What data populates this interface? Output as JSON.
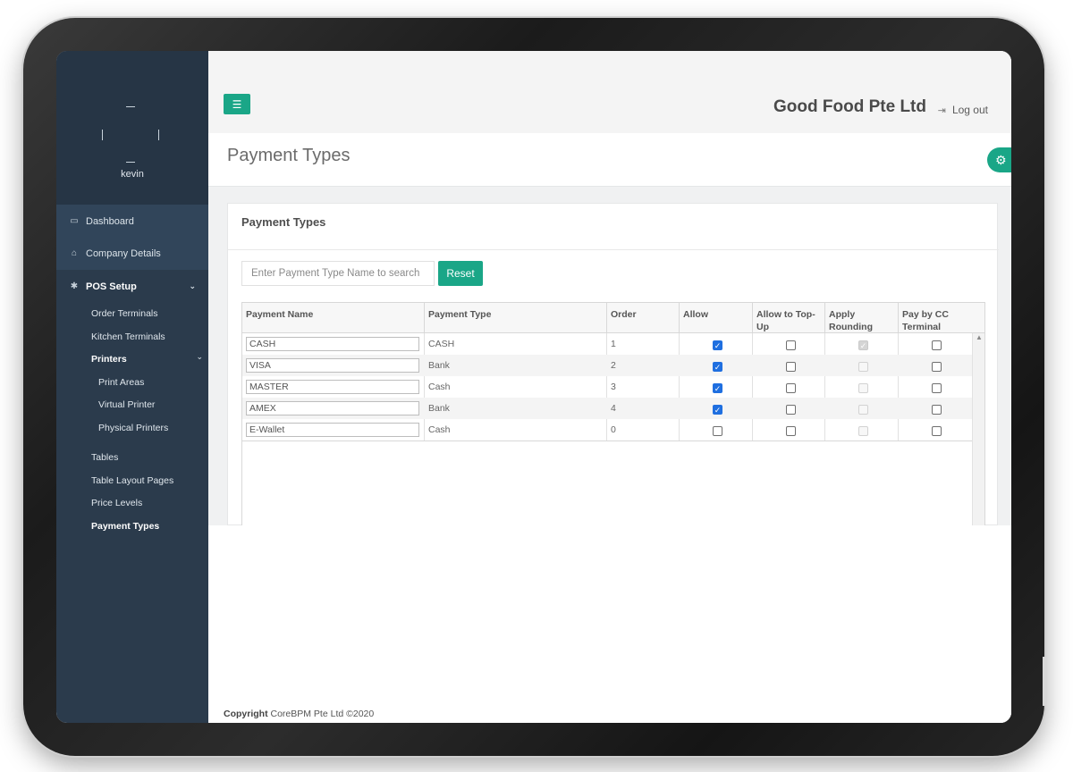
{
  "user": {
    "name": "kevin"
  },
  "sidebar": {
    "items": [
      {
        "label": "Dashboard",
        "icon": "monitor-icon"
      },
      {
        "label": "Company Details",
        "icon": "home-icon"
      },
      {
        "label": "POS Setup",
        "icon": "gear-icon"
      }
    ],
    "pos_setup": {
      "order_terminals": "Order Terminals",
      "kitchen_terminals": "Kitchen Terminals",
      "printers": "Printers",
      "printers_children": {
        "print_areas": "Print Areas",
        "virtual_printer": "Virtual Printer",
        "physical_printers": "Physical Printers"
      },
      "tables": "Tables",
      "table_layout_pages": "Table Layout Pages",
      "price_levels": "Price Levels",
      "payment_types": "Payment Types"
    }
  },
  "header": {
    "company": "Good Food Pte Ltd",
    "logout": "Log out"
  },
  "page": {
    "title": "Payment Types",
    "panel_title": "Payment Types"
  },
  "search": {
    "placeholder": "Enter Payment Type Name to search",
    "value": "",
    "reset_label": "Reset"
  },
  "table": {
    "columns": [
      "Payment Name",
      "Payment Type",
      "Order",
      "Allow",
      "Allow to Top-Up",
      "Apply Rounding",
      "Pay by CC Terminal"
    ],
    "rows": [
      {
        "name": "CASH",
        "type": "CASH",
        "order": "1",
        "allow": true,
        "topup": false,
        "rounding": true,
        "cc": false
      },
      {
        "name": "VISA",
        "type": "Bank",
        "order": "2",
        "allow": true,
        "topup": false,
        "rounding": false,
        "cc": false
      },
      {
        "name": "MASTER",
        "type": "Cash",
        "order": "3",
        "allow": true,
        "topup": false,
        "rounding": false,
        "cc": false
      },
      {
        "name": "AMEX",
        "type": "Bank",
        "order": "4",
        "allow": true,
        "topup": false,
        "rounding": false,
        "cc": false
      },
      {
        "name": "E-Wallet",
        "type": "Cash",
        "order": "0",
        "allow": false,
        "topup": false,
        "rounding": false,
        "cc": false
      }
    ]
  },
  "footer": {
    "copyright_label": "Copyright",
    "copyright_text": "CoreBPM Pte Ltd ©2020"
  },
  "colors": {
    "accent": "#1aa687",
    "sidebar": "#2b3b4c",
    "checkbox_checked": "#1f6fe0"
  }
}
